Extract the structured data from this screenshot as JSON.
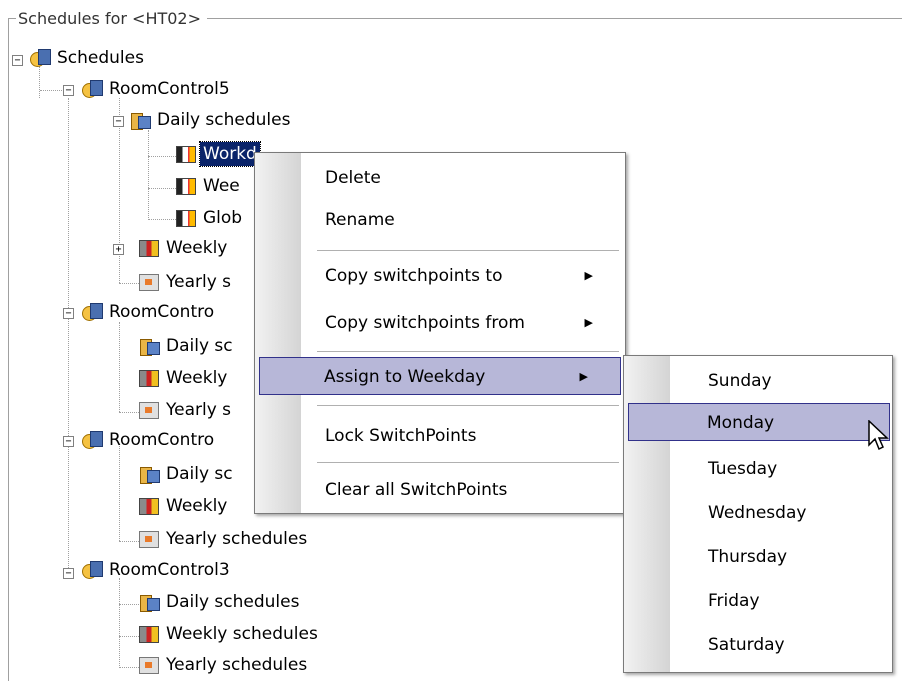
{
  "group_title": "Schedules for  <HT02>",
  "tree": {
    "root": "Schedules",
    "rc5": "RoomControl5",
    "rc5_daily": "Daily schedules",
    "rc5_daily_c1": "Workd",
    "rc5_daily_c2": "Wee",
    "rc5_daily_c3": "Glob",
    "rc5_weekly": "Weekly",
    "rc5_yearly": "Yearly s",
    "rc4": "RoomContro",
    "rc4_daily": "Daily sc",
    "rc4_weekly": "Weekly",
    "rc4_yearly": "Yearly s",
    "rcX": "RoomContro",
    "rcX_daily": "Daily sc",
    "rcX_weekly": "Weekly",
    "rcX_yearly": "Yearly schedules",
    "rc3": "RoomControl3",
    "rc3_daily": "Daily schedules",
    "rc3_weekly": "Weekly schedules",
    "rc3_yearly": "Yearly schedules"
  },
  "context_menu": {
    "delete": "Delete",
    "rename": "Rename",
    "copy_to": "Copy switchpoints to",
    "copy_from": "Copy switchpoints from",
    "assign": "Assign to Weekday",
    "lock": "Lock SwitchPoints",
    "clear": "Clear all SwitchPoints",
    "arrow": "▶"
  },
  "weekday_menu": {
    "sunday": "Sunday",
    "monday": "Monday",
    "tuesday": "Tuesday",
    "wednesday": "Wednesday",
    "thursday": "Thursday",
    "friday": "Friday",
    "saturday": "Saturday"
  },
  "colors": {
    "selection": "#0a246a",
    "menu_highlight": "#b7b7d8",
    "menu_highlight_border": "#31318a"
  }
}
